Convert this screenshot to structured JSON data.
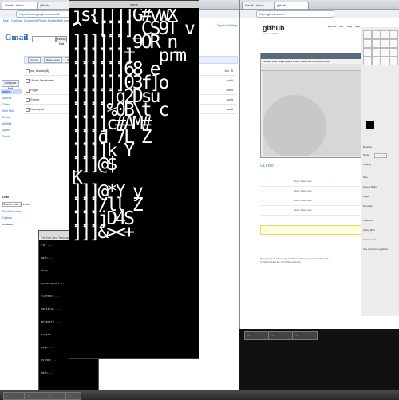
{
  "left_browser": {
    "tabs": [
      "Gmail - Inbox",
      "github - ..."
    ],
    "url": "https://mail.google.com/mail/",
    "top_links": [
      "Mail",
      "Calendar",
      "Documents",
      "Photos",
      "Reader",
      "Web",
      "more"
    ],
    "user_links": "Sign in | Settings",
    "logo": "Gmail",
    "search_button": "Search Mail",
    "nav": {
      "compose": "Compose Mail",
      "items": [
        "Inbox",
        "Starred",
        "Chats",
        "Sent Mail",
        "Drafts",
        "All Mail",
        "Spam",
        "Trash"
      ]
    },
    "toolbar": [
      "Archive",
      "Report spam",
      "Delete",
      "Move to",
      "Labels",
      "More actions"
    ],
    "rows": [
      {
        "from": "me, Ubuntu (8)",
        "subject": "Checkbook",
        "date": "Jun 15"
      },
      {
        "from": "Ubuntu Developers",
        "subject": "Ubuntu ...",
        "date": "Jun 9"
      },
      {
        "from": "Pidgin",
        "subject": "Pidgin ...",
        "date": "Jun 9"
      },
      {
        "from": "Gnome",
        "subject": "Gnome ...",
        "date": "Jun 9"
      },
      {
        "from": "Launchpad",
        "subject": "Bug ...",
        "date": "Jun 8"
      }
    ],
    "sidebar_bottom": [
      "Chat",
      "Search, add, or invite",
      "Set status here",
      "Options",
      "contacts"
    ]
  },
  "small_terminal": {
    "title": "",
    "menu": "File  Edit  View  Terminal  Help",
    "lines": [
      "PID  ...",
      "bash  ...",
      "Xorg  ...",
      "gnome-panel ...",
      "firefox ...",
      "nautilus ...",
      "metacity ...",
      "pidgin ...",
      "gimp ...",
      "python ...",
      "bash ..."
    ]
  },
  "big_terminal": {
    "title": "xterm",
    "text": "js{[]]]G#vWX\n^ `[]]]_CS9T v\n]]]]]]_9OR n\n]]]]]]]   prm\n]]]]]]68 e\n]]]]]]03f]o\n]]]]]q2Dsu\n]]]]%0B\\t c\n]]]]c#AM#\n]]]d 7L Z\n]]]]k Y\n]]]@$\nK \n]]]@*Y y\n]]]/ll Z\n]]]jD4S\n]]]&><+"
  },
  "right_browser": {
    "tabs": [
      "Gmail - Inbox",
      "github ..."
    ],
    "url": "http://github.com/...",
    "logo": "github",
    "logo_sub": "SOCIAL CODING",
    "top_nav": [
      "Explore",
      "Gist",
      "Blog",
      "Help"
    ],
    "screenshot_title": "...",
    "screenshot_menu": "File  Edit  View  Image  Layers  Colors  Tools  Filters  Windows  Help",
    "repo_title": "GLFont /",
    "table_rows": [
      {
        "name": "...",
        "age": "about 1 hour ago",
        "msg": "..."
      },
      {
        "name": "...",
        "age": "about 1 hour ago",
        "msg": "..."
      },
      {
        "name": "...",
        "age": "about 1 hour ago",
        "msg": "..."
      },
      {
        "name": "...",
        "age": "about 1 hour ago",
        "msg": "..."
      }
    ],
    "notice": "...",
    "footer": "Blog  |  Support  |  Training  |  Job Board  |  Shop  |  Contact  |  API  |  Status",
    "footer_copy": "© 2010 GitHub Inc. All rights reserved.",
    "status": "..."
  },
  "gimp": {
    "labels": [
      "Brushes",
      "Mode",
      "Normal",
      "Opacity",
      "Size",
      "Aspect Ratio",
      "Angle",
      "Dynamics",
      "Fade out",
      "Apply Jitter",
      "Incremental",
      "Use color from gradient"
    ]
  },
  "right_tasks": [
    "...",
    "...",
    "..."
  ],
  "taskbar": {
    "items": [
      "...",
      "...",
      "...",
      "..."
    ],
    "clock": "..."
  }
}
